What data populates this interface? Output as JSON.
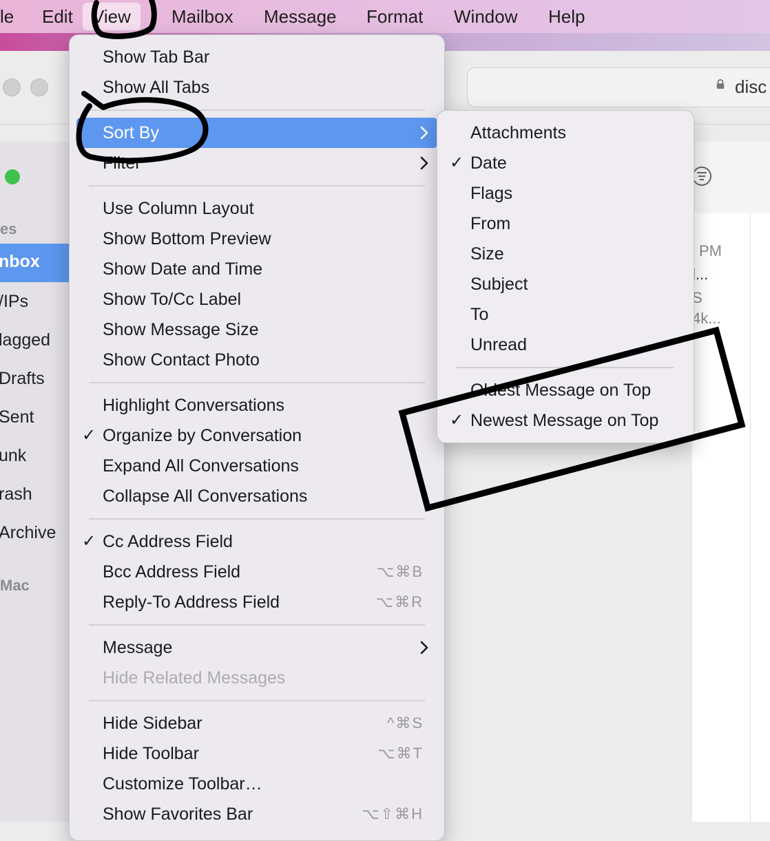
{
  "menubar": {
    "items": [
      "le",
      "Edit",
      "View",
      "Mailbox",
      "Message",
      "Format",
      "Window",
      "Help"
    ]
  },
  "window": {
    "address": "disc",
    "sidebar": {
      "header": "es",
      "items": [
        "nbox",
        "/IPs",
        "lagged",
        "Drafts",
        "Sent",
        "unk",
        "rash",
        "Archive"
      ],
      "section": "Mac"
    },
    "preview": [
      "PM",
      "l...",
      "S",
      "4k..."
    ]
  },
  "view_menu": {
    "items": [
      {
        "label": "Show Tab Bar"
      },
      {
        "label": "Show All Tabs"
      },
      {
        "sep": true
      },
      {
        "label": "Sort By",
        "submenu": true,
        "highlighted": true
      },
      {
        "label": "Filter",
        "submenu": true
      },
      {
        "sep": true
      },
      {
        "label": "Use Column Layout"
      },
      {
        "label": "Show Bottom Preview"
      },
      {
        "label": "Show Date and Time"
      },
      {
        "label": "Show To/Cc Label"
      },
      {
        "label": "Show Message Size"
      },
      {
        "label": "Show Contact Photo"
      },
      {
        "sep": true
      },
      {
        "label": "Highlight Conversations"
      },
      {
        "label": "Organize by Conversation",
        "checked": true
      },
      {
        "label": "Expand All Conversations"
      },
      {
        "label": "Collapse All Conversations"
      },
      {
        "sep": true
      },
      {
        "label": "Cc Address Field",
        "checked": true
      },
      {
        "label": "Bcc Address Field",
        "shortcut": "⌥⌘B"
      },
      {
        "label": "Reply-To Address Field",
        "shortcut": "⌥⌘R"
      },
      {
        "sep": true
      },
      {
        "label": "Message",
        "submenu": true
      },
      {
        "label": "Hide Related Messages",
        "disabled": true
      },
      {
        "sep": true
      },
      {
        "label": "Hide Sidebar",
        "shortcut": "^⌘S"
      },
      {
        "label": "Hide Toolbar",
        "shortcut": "⌥⌘T"
      },
      {
        "label": "Customize Toolbar…"
      },
      {
        "label": "Show Favorites Bar",
        "shortcut": "⌥⇧⌘H"
      }
    ]
  },
  "sort_by_menu": {
    "items": [
      {
        "label": "Attachments"
      },
      {
        "label": "Date",
        "checked": true
      },
      {
        "label": "Flags"
      },
      {
        "label": "From"
      },
      {
        "label": "Size"
      },
      {
        "label": "Subject"
      },
      {
        "label": "To"
      },
      {
        "label": "Unread"
      },
      {
        "sep": true
      },
      {
        "label": "Oldest Message on Top"
      },
      {
        "label": "Newest Message on Top",
        "checked": true
      }
    ]
  },
  "glyphs": {
    "check": "✓",
    "chevron": "›"
  },
  "colors": {
    "highlight": "#5d97f0",
    "annotation": "#000000"
  }
}
